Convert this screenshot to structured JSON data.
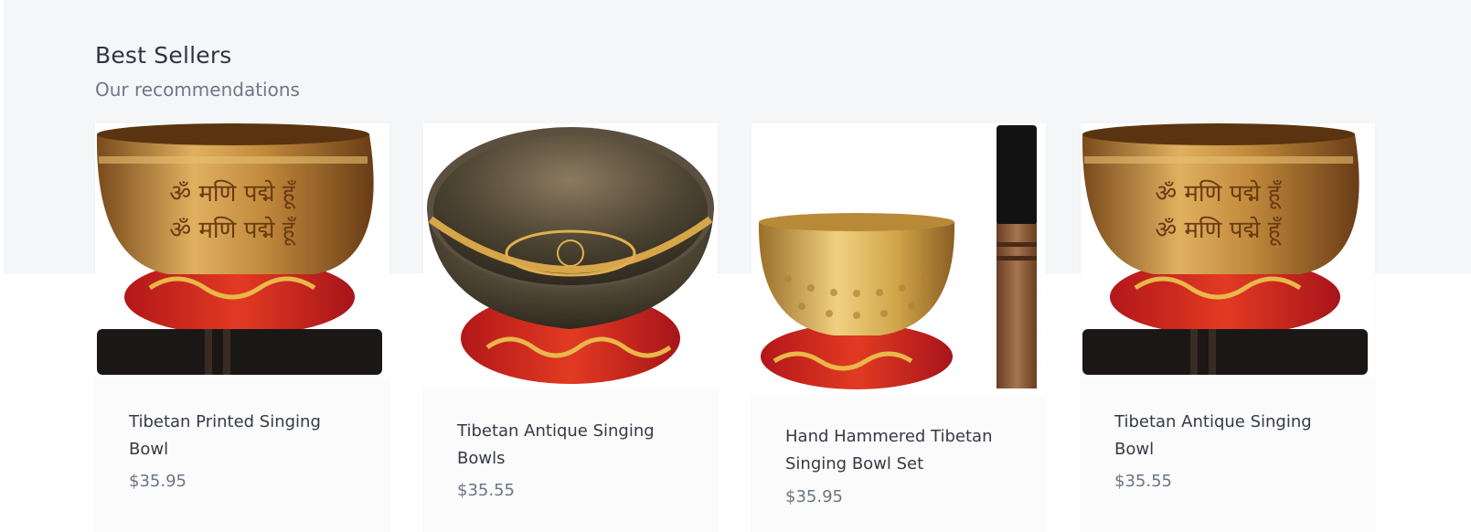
{
  "section": {
    "title": "Best Sellers",
    "subtitle": "Our recommendations"
  },
  "products": [
    {
      "name": "Tibetan Printed Singing Bowl",
      "price": "$35.95",
      "image_icon": "printed-singing-bowl-with-mallet"
    },
    {
      "name": "Tibetan Antique Singing Bowls",
      "price": "$35.55",
      "image_icon": "antique-singing-bowl-on-cushion"
    },
    {
      "name": "Hand Hammered Tibetan Singing Bowl Set",
      "price": "$35.95",
      "image_icon": "hammered-singing-bowl-set"
    },
    {
      "name": "Tibetan Antique Singing Bowl",
      "price": "$35.55",
      "image_icon": "printed-singing-bowl-with-mallet"
    }
  ],
  "colors": {
    "band": "#f5f6f8",
    "gold": "#c48a3a",
    "cushion_red": "#d8251f",
    "mallet": "#1a1716"
  }
}
